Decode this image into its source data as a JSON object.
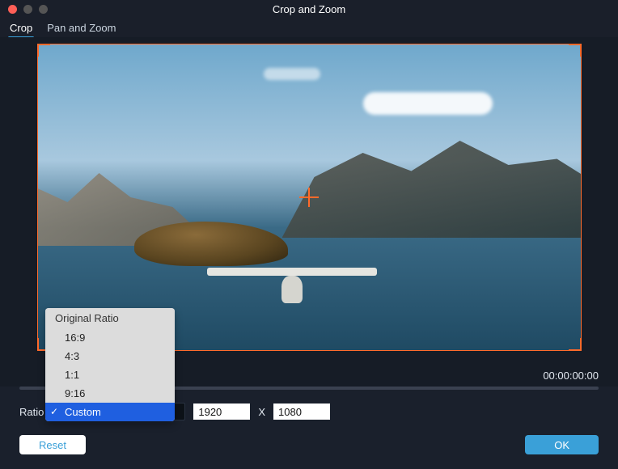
{
  "window": {
    "title": "Crop and Zoom"
  },
  "tabs": {
    "crop": "Crop",
    "pan_zoom": "Pan and Zoom",
    "active": "crop"
  },
  "timecode": "00:00:00:00",
  "controls": {
    "ratio_label": "Ratio",
    "width": "1920",
    "separator": "X",
    "height": "1080"
  },
  "dropdown": {
    "header": "Original Ratio",
    "items": [
      "16:9",
      "4:3",
      "1:1",
      "9:16",
      "Custom"
    ],
    "selected": "Custom"
  },
  "buttons": {
    "reset": "Reset",
    "ok": "OK"
  },
  "colors": {
    "accent": "#3aa0d8",
    "crop_border": "#ff6a2a"
  }
}
